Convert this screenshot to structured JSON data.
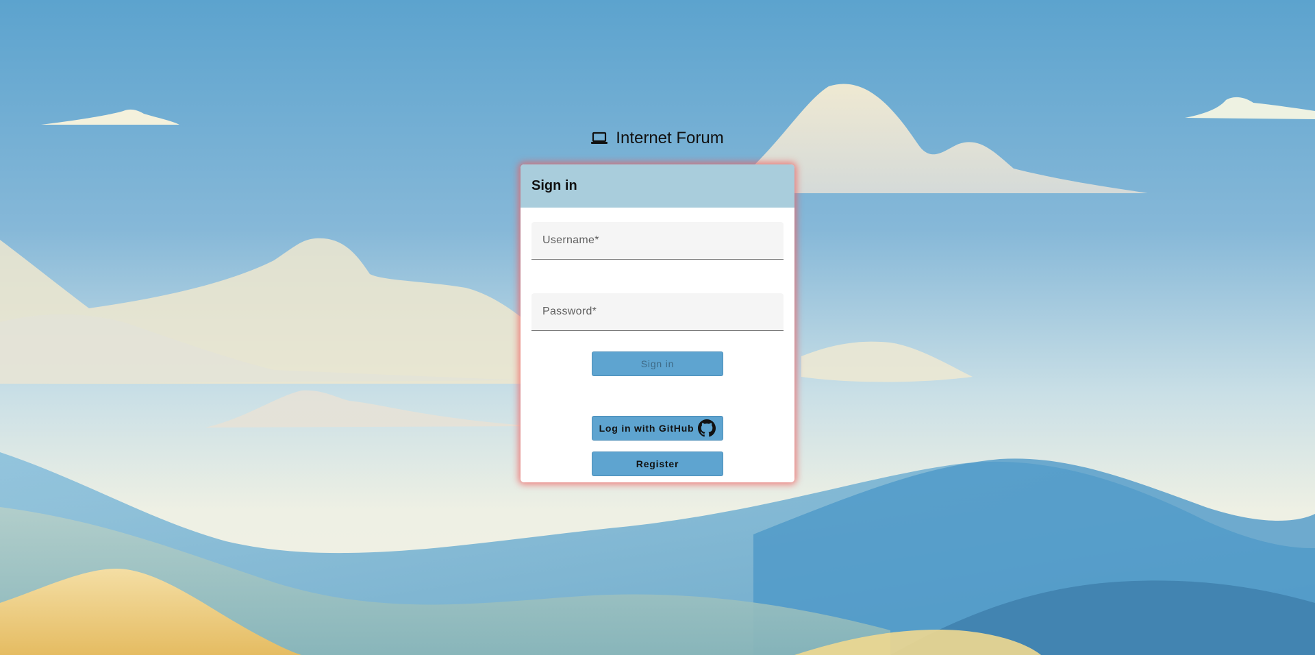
{
  "app": {
    "title": "Internet Forum",
    "icon": "laptop-icon"
  },
  "signin_card": {
    "header": "Sign in",
    "username": {
      "placeholder": "Username*",
      "value": ""
    },
    "password": {
      "placeholder": "Password*",
      "value": ""
    },
    "signin_button": {
      "label": "Sign in",
      "state": "disabled"
    },
    "github_button": {
      "label": "Log in with GitHub",
      "icon": "github-icon"
    },
    "register_button": {
      "label": "Register"
    }
  },
  "colors": {
    "header_bg": "#a9cddc",
    "button_bg": "#5ea4d0",
    "card_glow": "#f05a5a"
  }
}
